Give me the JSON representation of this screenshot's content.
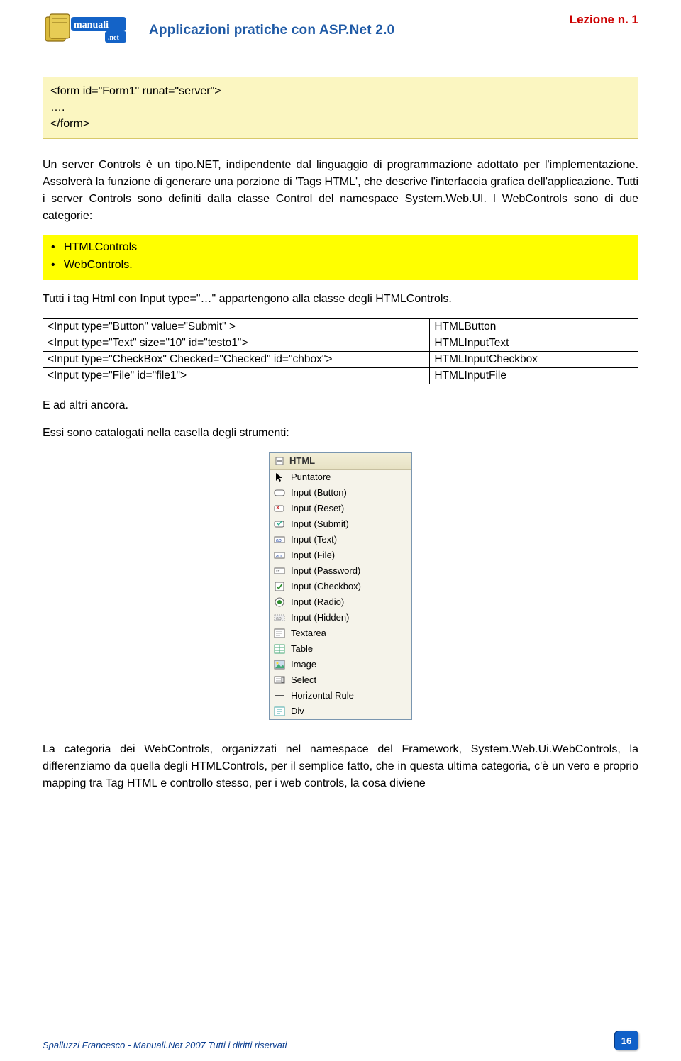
{
  "header": {
    "title": "Applicazioni pratiche con ASP.Net 2.0",
    "lesson": "Lezione n. 1",
    "logo_text_top": "manuali",
    "logo_text_bottom": ".net"
  },
  "codebox1": "<form id=\"Form1\" runat=\"server\">\n….\n</form>",
  "para1": "Un server Controls è un tipo.NET, indipendente dal linguaggio di programmazione adottato per l'implementazione. Assolverà la funzione di generare una porzione di 'Tags HTML', che descrive l'interfaccia grafica dell'applicazione. Tutti i server Controls sono definiti dalla classe Control del namespace System.Web.UI. I WebControls sono di due categorie:",
  "bullets": [
    "HTMLControls",
    "WebControls."
  ],
  "para2": "Tutti i tag Html con Input type=\"…\" appartengono alla classe degli HTMLControls.",
  "table": [
    {
      "l": "<Input type=\"Button\" value=\"Submit\" >",
      "r": "HTMLButton"
    },
    {
      "l": "<Input type=\"Text\" size=\"10\" id=\"testo1\">",
      "r": "HTMLInputText"
    },
    {
      "l": "<Input type=\"CheckBox\" Checked=\"Checked\" id=\"chbox\">",
      "r": "HTMLInputCheckbox"
    },
    {
      "l": "<Input type=\"File\" id=\"file1\">",
      "r": "HTMLInputFile"
    }
  ],
  "para3": "E ad altri ancora.",
  "para4": "Essi sono catalogati nella casella degli strumenti:",
  "toolbox": {
    "header": "HTML",
    "items": [
      {
        "icon": "pointer",
        "label": "Puntatore"
      },
      {
        "icon": "button",
        "label": "Input (Button)"
      },
      {
        "icon": "reset",
        "label": "Input (Reset)"
      },
      {
        "icon": "submit",
        "label": "Input (Submit)"
      },
      {
        "icon": "text",
        "label": "Input (Text)"
      },
      {
        "icon": "file",
        "label": "Input (File)"
      },
      {
        "icon": "password",
        "label": "Input (Password)"
      },
      {
        "icon": "checkbox",
        "label": "Input (Checkbox)"
      },
      {
        "icon": "radio",
        "label": "Input (Radio)"
      },
      {
        "icon": "hidden",
        "label": "Input (Hidden)"
      },
      {
        "icon": "textarea",
        "label": "Textarea"
      },
      {
        "icon": "table",
        "label": "Table"
      },
      {
        "icon": "image",
        "label": "Image"
      },
      {
        "icon": "select",
        "label": "Select"
      },
      {
        "icon": "hr",
        "label": "Horizontal Rule"
      },
      {
        "icon": "div",
        "label": "Div"
      }
    ]
  },
  "para5": "La categoria dei WebControls, organizzati nel namespace del Framework, System.Web.Ui.WebControls, la differenziamo da quella degli HTMLControls, per il semplice fatto, che in questa ultima categoria, c'è un vero e proprio mapping tra Tag HTML e controllo stesso, per i web controls, la cosa diviene",
  "footer": {
    "left_author": "Spalluzzi Francesco ",
    "left_site": "- Manuali.Net",
    "left_copy": " 2007 Tutti i diritti riservati",
    "page": "16"
  }
}
